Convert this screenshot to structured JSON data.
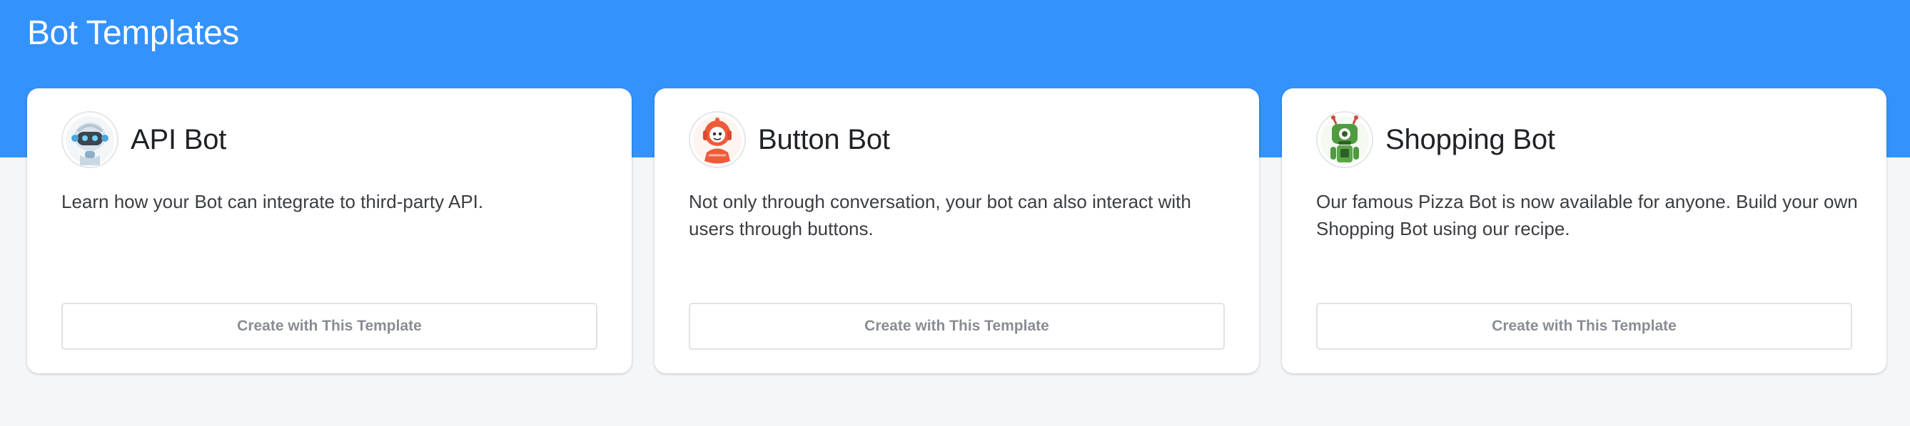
{
  "page": {
    "title": "Bot Templates"
  },
  "colors": {
    "header_background": "#3492fc",
    "page_background": "#f5f6f8",
    "card_background": "#ffffff",
    "button_text": "#888d94"
  },
  "templates": [
    {
      "name": "API Bot",
      "description": "Learn how your Bot can integrate to third-party API.",
      "button_label": "Create with This Template",
      "avatar_icon": "robot-avatar-icon"
    },
    {
      "name": "Button Bot",
      "description": "Not only through conversation, your bot can also interact with users through buttons.",
      "button_label": "Create with This Template",
      "avatar_icon": "robot-avatar-icon"
    },
    {
      "name": "Shopping Bot",
      "description": "Our famous Pizza Bot is now available for anyone. Build your own Shopping Bot using our recipe.",
      "button_label": "Create with This Template",
      "avatar_icon": "robot-avatar-icon"
    }
  ]
}
